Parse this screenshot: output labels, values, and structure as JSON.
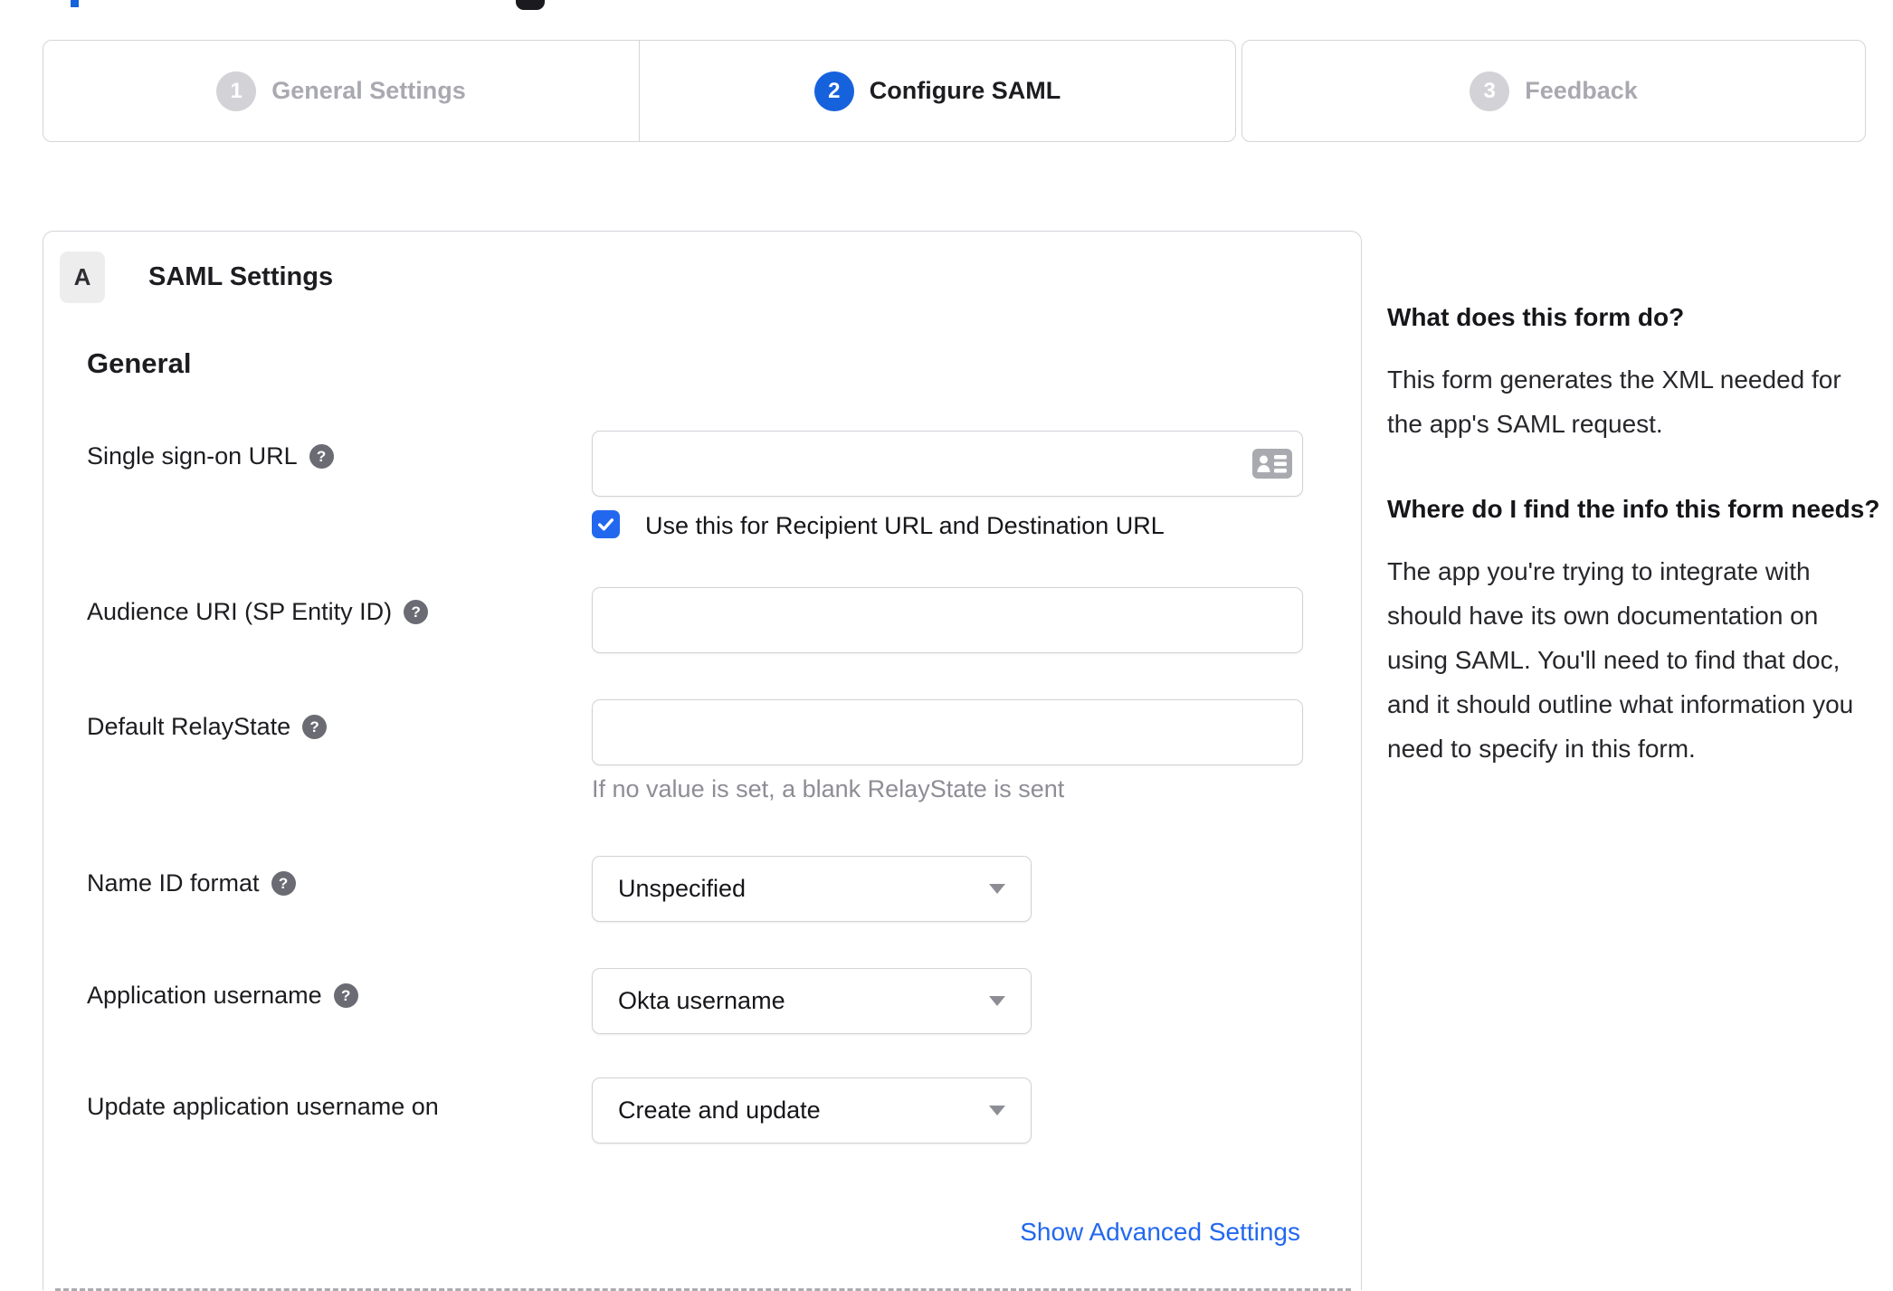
{
  "stepper": {
    "steps": [
      {
        "number": "1",
        "label": "General Settings",
        "state": "inactive"
      },
      {
        "number": "2",
        "label": "Configure SAML",
        "state": "active"
      },
      {
        "number": "3",
        "label": "Feedback",
        "state": "inactive"
      }
    ]
  },
  "panel": {
    "section_badge": "A",
    "section_title": "SAML Settings",
    "group_title": "General",
    "fields": [
      {
        "label": "Single sign-on URL",
        "type": "text",
        "value": "",
        "checkbox_label": "Use this for Recipient URL and Destination URL",
        "checkbox_checked": true
      },
      {
        "label": "Audience URI (SP Entity ID)",
        "type": "text",
        "value": ""
      },
      {
        "label": "Default RelayState",
        "type": "text",
        "value": "",
        "helper": "If no value is set, a blank RelayState is sent"
      },
      {
        "label": "Name ID format",
        "type": "select",
        "value": "Unspecified"
      },
      {
        "label": "Application username",
        "type": "select",
        "value": "Okta username"
      },
      {
        "label": "Update application username on",
        "type": "select",
        "value": "Create and update"
      }
    ],
    "advanced_link": "Show Advanced Settings"
  },
  "sidebar": {
    "sections": [
      {
        "heading": "What does this form do?",
        "body": "This form generates the XML needed for the app's SAML request."
      },
      {
        "heading": "Where do I find the info this form needs?",
        "body": "The app you're trying to integrate with should have its own documentation on using SAML. You'll need to find that doc, and it should outline what information you need to specify in this form."
      }
    ]
  },
  "colors": {
    "accent_blue": "#1662dd",
    "link_blue": "#2268ef",
    "checkbox_blue": "#2268ef",
    "border_gray": "#d5d5da",
    "inactive_gray": "#a9a9b0",
    "text_dark": "#1d1d21",
    "helper_gray": "#8d8d95"
  }
}
